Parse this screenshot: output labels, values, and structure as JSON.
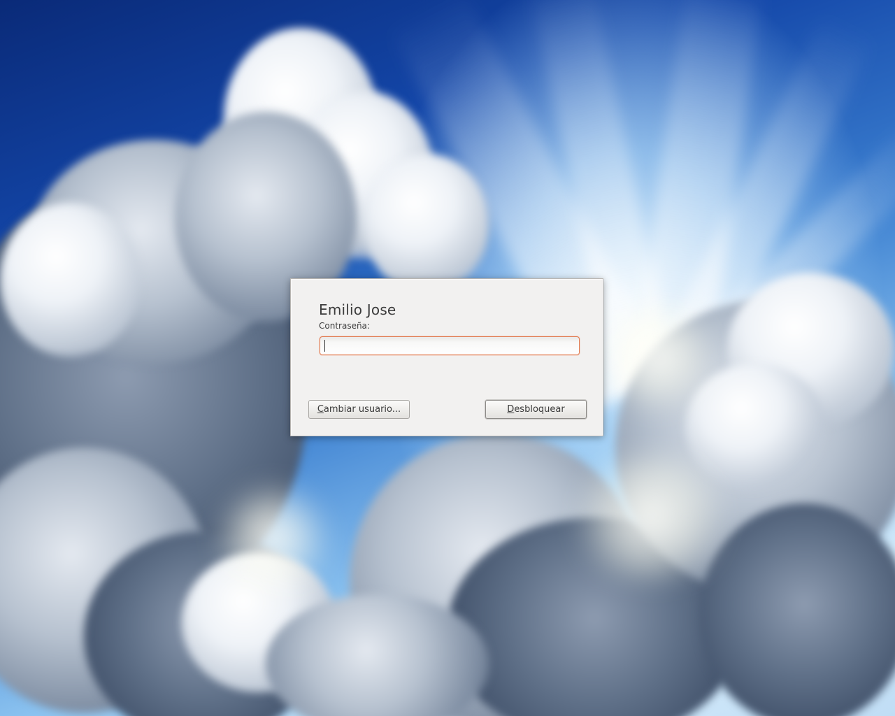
{
  "lock_dialog": {
    "user_name": "Emilio Jose",
    "password_label": "Contraseña:",
    "password_value": "",
    "switch_user_mnemonic": "C",
    "switch_user_rest": "ambiar usuario...",
    "unlock_mnemonic": "D",
    "unlock_rest": "esbloquear"
  },
  "colors": {
    "dialog_background": "#f2f1f0",
    "input_focus_border": "#e07a4f",
    "sky_dark": "#0a2a78",
    "sky_light": "#d6ecfb"
  }
}
